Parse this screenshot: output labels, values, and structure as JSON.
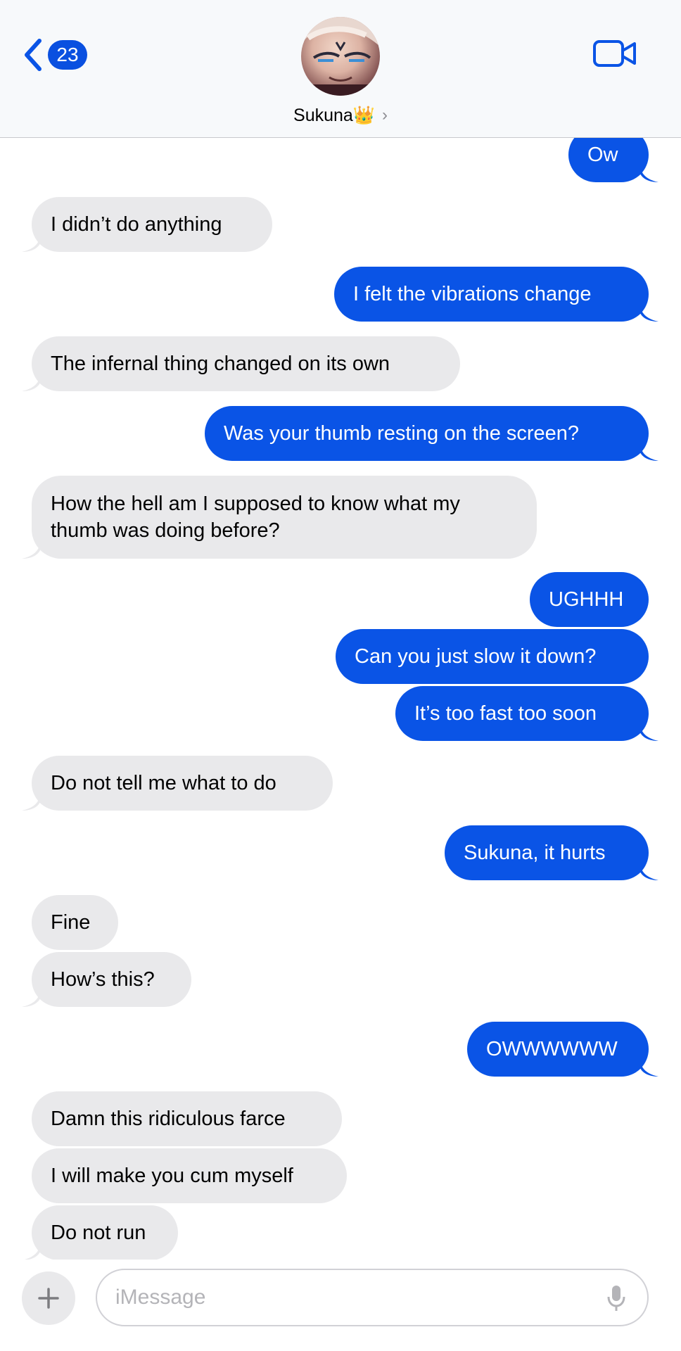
{
  "header": {
    "back_badge": "23",
    "contact_name": "Sukuna👑",
    "contact_chevron": "›",
    "back_icon": "chevron-left-icon",
    "video_icon": "video-camera-icon",
    "accent_color": "#0a54e6"
  },
  "messages": [
    {
      "from": "me",
      "text": "Ow"
    },
    {
      "from": "them",
      "text": "I didn’t do anything"
    },
    {
      "from": "me",
      "text": "I felt the vibrations change"
    },
    {
      "from": "them",
      "text": "The infernal thing changed on its own"
    },
    {
      "from": "me",
      "text": "Was your thumb resting on the screen?"
    },
    {
      "from": "them",
      "text": "How the hell am I supposed to know what my thumb was doing before?"
    },
    {
      "from": "me",
      "text": "UGHHH"
    },
    {
      "from": "me",
      "text": "Can you just slow it down?"
    },
    {
      "from": "me",
      "text": "It’s too fast too soon"
    },
    {
      "from": "them",
      "text": "Do not tell me what to do"
    },
    {
      "from": "me",
      "text": "Sukuna, it hurts"
    },
    {
      "from": "them",
      "text": "Fine"
    },
    {
      "from": "them",
      "text": "How’s this?"
    },
    {
      "from": "me",
      "text": "OWWWWWW"
    },
    {
      "from": "them",
      "text": "Damn this ridiculous farce"
    },
    {
      "from": "them",
      "text": "I will make you cum myself"
    },
    {
      "from": "them",
      "text": "Do not run"
    }
  ],
  "input": {
    "placeholder": "iMessage",
    "plus_icon": "plus-icon",
    "mic_icon": "microphone-icon"
  }
}
